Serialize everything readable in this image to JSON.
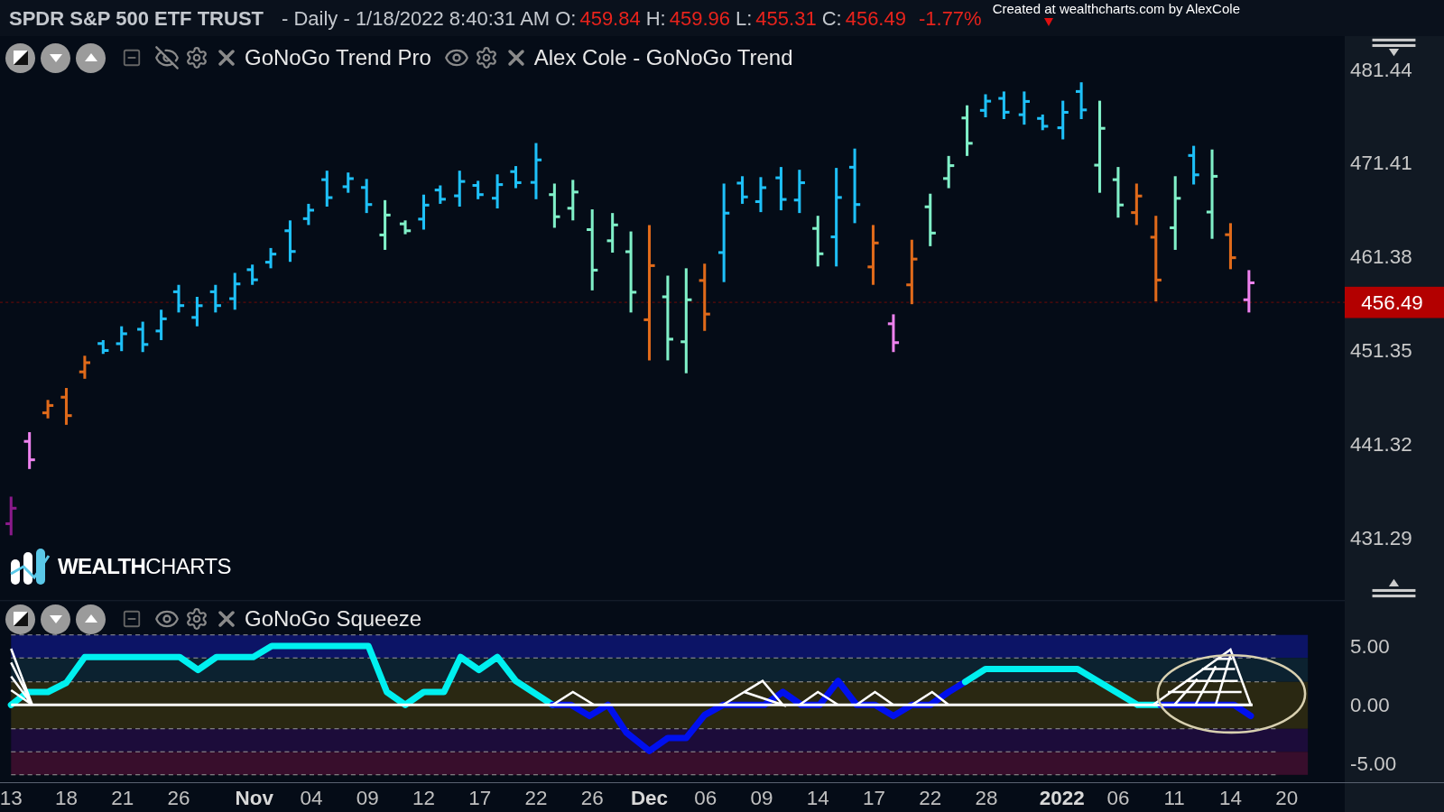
{
  "header": {
    "symbol": "SPDR S&P 500 ETF TRUST",
    "interval_and_time": "- Daily - 1/18/2022 8:40:31 AM",
    "ohlc": [
      {
        "label": "O:",
        "value": "459.84"
      },
      {
        "label": "H:",
        "value": "459.96"
      },
      {
        "label": "L:",
        "value": "455.31"
      },
      {
        "label": "C:",
        "value": "456.49"
      }
    ],
    "change": "-1.77%",
    "credit": "Created at wealthcharts.com by AlexCole"
  },
  "price_pane": {
    "indicators": [
      {
        "name": "GoNoGo Trend Pro",
        "visible": false
      },
      {
        "name": "Alex Cole - GoNoGo Trend",
        "visible": true
      }
    ],
    "y_ticks": [
      "481.44",
      "471.41",
      "461.38",
      "451.35",
      "441.32",
      "431.29"
    ],
    "last_price": "456.49"
  },
  "logo": "**WEALTH**CHARTS",
  "squeeze_pane": {
    "indicators": [
      {
        "name": "GoNoGo Squeeze",
        "visible": true
      }
    ],
    "y_ticks": [
      "5.00",
      "0.00",
      "-5.00"
    ]
  },
  "x_axis": [
    {
      "label": "13",
      "major": false
    },
    {
      "label": "18",
      "major": false
    },
    {
      "label": "21",
      "major": false
    },
    {
      "label": "26",
      "major": false
    },
    {
      "label": "Nov",
      "major": true
    },
    {
      "label": "04",
      "major": false
    },
    {
      "label": "09",
      "major": false
    },
    {
      "label": "12",
      "major": false
    },
    {
      "label": "17",
      "major": false
    },
    {
      "label": "22",
      "major": false
    },
    {
      "label": "26",
      "major": false
    },
    {
      "label": "Dec",
      "major": true
    },
    {
      "label": "06",
      "major": false
    },
    {
      "label": "09",
      "major": false
    },
    {
      "label": "14",
      "major": false
    },
    {
      "label": "17",
      "major": false
    },
    {
      "label": "22",
      "major": false
    },
    {
      "label": "28",
      "major": false
    },
    {
      "label": "2022",
      "major": true
    },
    {
      "label": "06",
      "major": false
    },
    {
      "label": "11",
      "major": false
    },
    {
      "label": "14",
      "major": false
    },
    {
      "label": "20",
      "major": false
    }
  ]
}
